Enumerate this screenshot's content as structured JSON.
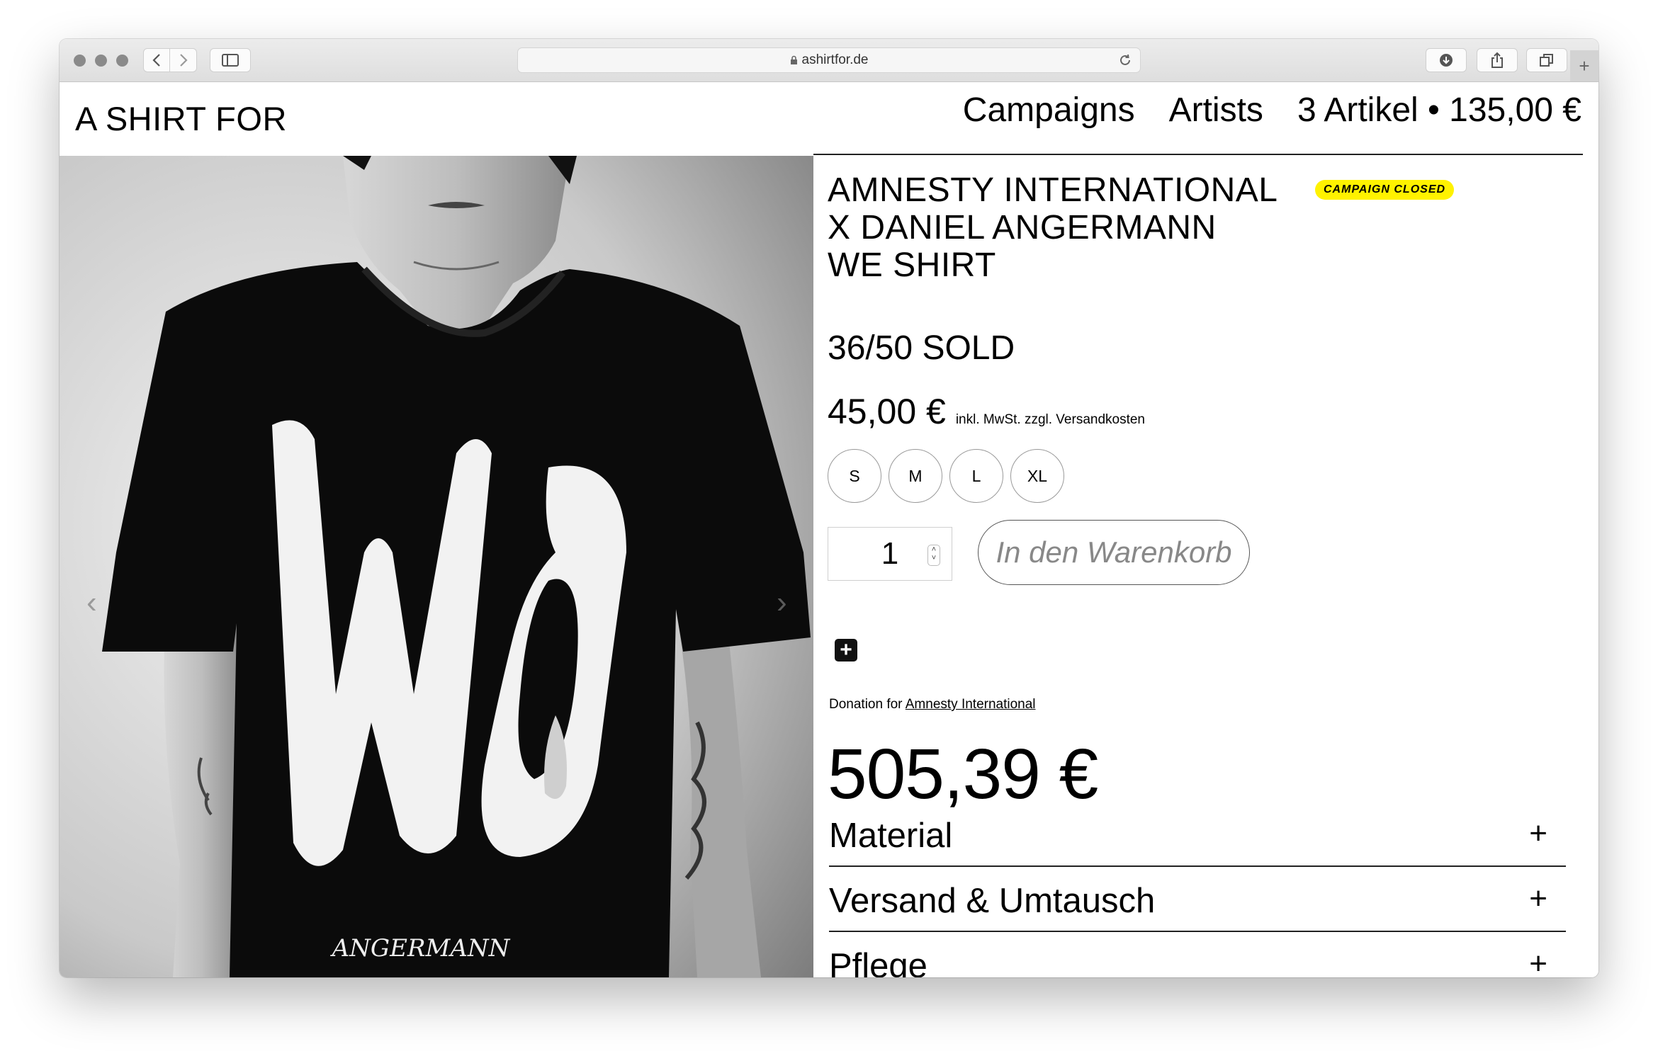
{
  "browser": {
    "url": "ashirtfor.de"
  },
  "site": {
    "logo": "A SHIRT FOR",
    "nav": {
      "campaigns": "Campaigns",
      "artists": "Artists",
      "cart": "3 Artikel • 135,00 €"
    }
  },
  "product": {
    "title_lines": [
      "AMNESTY INTERNATIONAL",
      "X DANIEL ANGERMANN",
      "WE SHIRT"
    ],
    "badge": "CAMPAIGN CLOSED",
    "sold": "36/50 SOLD",
    "price": "45,00 €",
    "price_note": "inkl. MwSt. zzgl. Versandkosten",
    "sizes": [
      "S",
      "M",
      "L",
      "XL"
    ],
    "quantity": "1",
    "add_to_cart": "In den Warenkorb",
    "donation_prefix": "Donation for",
    "donation_org": "Amnesty International",
    "donation_amount": "505,39 €",
    "accordion": [
      {
        "label": "Material",
        "toggle": "+"
      },
      {
        "label": "Versand & Umtausch",
        "toggle": "+"
      },
      {
        "label": "Pflege",
        "toggle": "+"
      }
    ]
  },
  "gallery": {
    "shirt_print": "WO",
    "shirt_signature": "ANGERMANN",
    "prev_arrow": "‹",
    "next_arrow": "›"
  },
  "colors": {
    "badge": "#fff200",
    "text": "#000000"
  }
}
